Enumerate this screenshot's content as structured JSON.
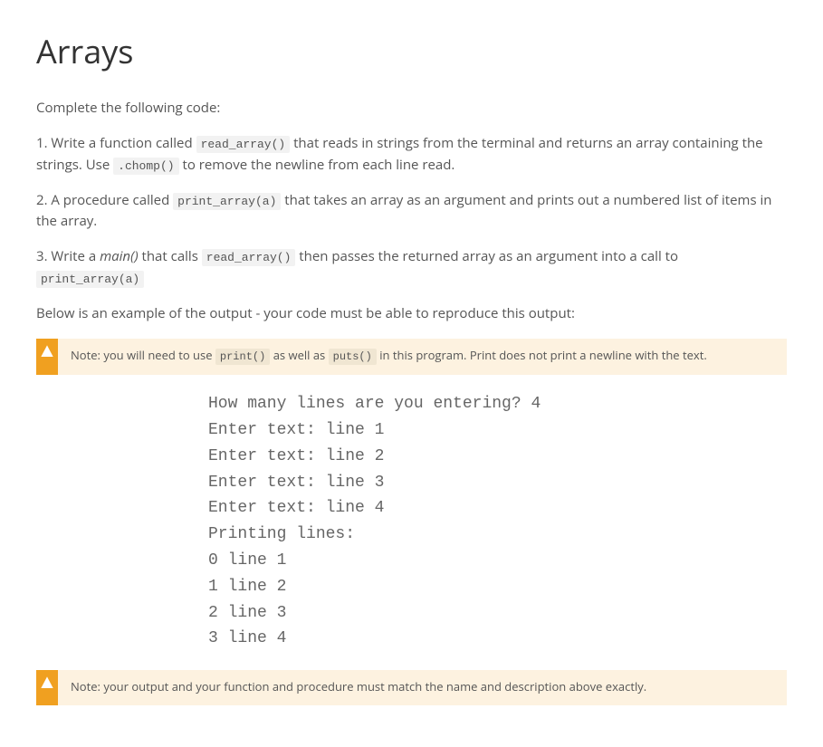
{
  "title": "Arrays",
  "intro": "Complete the following code:",
  "p1": {
    "t1": "1. Write a function called ",
    "c1": "read_array()",
    "t2": " that reads in strings from the terminal and returns an array containing the strings. Use ",
    "c2": ".chomp()",
    "t3": " to remove the newline from each line read."
  },
  "p2": {
    "t1": "2. A procedure called ",
    "c1": "print_array(a)",
    "t2": " that takes an array as an argument and prints out a numbered list of items in the array."
  },
  "p3": {
    "t1": "3. Write a ",
    "em1": "main()",
    "t2": " that calls ",
    "c1": "read_array()",
    "t3": " then passes the returned array as an argument into a call to ",
    "c2": "print_array(a)"
  },
  "p4": "Below is an example of the output - your code must be able to reproduce this output:",
  "note1": {
    "t1": "Note: you will need to use ",
    "c1": "print()",
    "t2": " as well as ",
    "c2": "puts()",
    "t3": " in this program. Print does not print a newline with the text."
  },
  "output": "How many lines are you entering? 4\nEnter text: line 1\nEnter text: line 2\nEnter text: line 3\nEnter text: line 4\nPrinting lines:\n0 line 1\n1 line 2\n2 line 3\n3 line 4",
  "note2": {
    "t1": "Note: your output and your function and procedure must match the name and description above exactly."
  }
}
